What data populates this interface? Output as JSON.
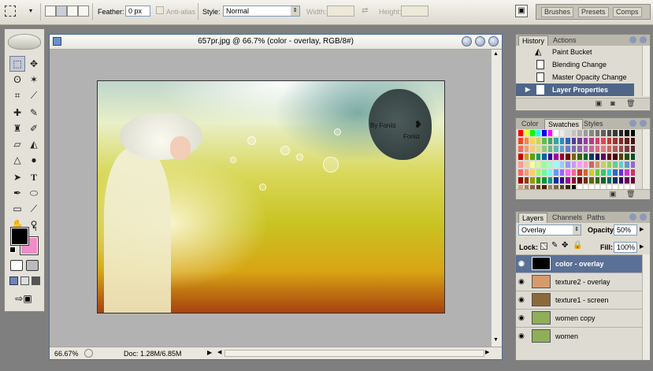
{
  "options_bar": {
    "feather_label": "Feather:",
    "feather_value": "0 px",
    "antialias_label": "Anti-alias",
    "style_label": "Style:",
    "style_value": "Normal",
    "width_label": "Width:",
    "height_label": "Height:"
  },
  "palette_well": {
    "tabs": [
      "Brushes",
      "Presets",
      "Comps"
    ]
  },
  "document": {
    "title": "657pr.jpg @ 66.7% (color - overlay, RGB/8#)",
    "zoom": "66.67%",
    "doc_info": "Doc: 1.28M/6.85M",
    "artwork_text_1": "By Foniiz",
    "artwork_text_2": "Foniiz"
  },
  "history_panel": {
    "tabs": [
      "History",
      "Actions"
    ],
    "items": [
      {
        "label": "Paint Bucket",
        "selected": false
      },
      {
        "label": "Blending Change",
        "selected": false
      },
      {
        "label": "Master Opacity Change",
        "selected": false
      },
      {
        "label": "Layer Properties",
        "selected": true
      }
    ]
  },
  "swatches_panel": {
    "tabs": [
      "Color",
      "Swatches",
      "Styles"
    ],
    "colors": [
      "#ff0000",
      "#ffff00",
      "#00ff00",
      "#00ffff",
      "#0000ff",
      "#ff00ff",
      "#ffffff",
      "#ebebeb",
      "#d7d7d7",
      "#c3c3c3",
      "#afafaf",
      "#9b9b9b",
      "#878787",
      "#737373",
      "#5f5f5f",
      "#4b4b4b",
      "#373737",
      "#232323",
      "#0f0f0f",
      "#000000",
      "#f0462d",
      "#f5873c",
      "#fad250",
      "#c8dc3c",
      "#64be46",
      "#3caa64",
      "#32a5a0",
      "#2d8cc8",
      "#3264b4",
      "#503ca0",
      "#6e3c9b",
      "#913ca0",
      "#b43c8c",
      "#d23c6e",
      "#e1465a",
      "#be3c3c",
      "#a03232",
      "#822828",
      "#641e1e",
      "#461414",
      "#f26d5b",
      "#f49d6e",
      "#f7c87e",
      "#d6e07a",
      "#8fcc7b",
      "#69b98a",
      "#63b7b3",
      "#5fa1d2",
      "#6682c2",
      "#7d68b3",
      "#9067ad",
      "#aa66b0",
      "#c867a0",
      "#e06a86",
      "#e57a82",
      "#cc6666",
      "#b45a5a",
      "#964b4b",
      "#783c3c",
      "#5a2d2d",
      "#c80000",
      "#c8a000",
      "#64a000",
      "#00a064",
      "#0064a0",
      "#3200a0",
      "#a000a0",
      "#a00032",
      "#780000",
      "#786400",
      "#3c6400",
      "#00643c",
      "#003c64",
      "#1e0064",
      "#640064",
      "#64001e",
      "#500000",
      "#504000",
      "#285000",
      "#005028",
      "#ff9999",
      "#ffcc99",
      "#ffff99",
      "#ccff99",
      "#99ff99",
      "#99ffcc",
      "#99ffff",
      "#99ccff",
      "#9999ff",
      "#cc99ff",
      "#ff99ff",
      "#ff99cc",
      "#cc6666",
      "#cc9966",
      "#cccc66",
      "#99cc66",
      "#66cc99",
      "#66cccc",
      "#6699cc",
      "#9966cc",
      "#ff6666",
      "#ff9966",
      "#ffcc66",
      "#99ff66",
      "#66ff99",
      "#66ffff",
      "#6699ff",
      "#9966ff",
      "#ff66ff",
      "#ff6699",
      "#cc3333",
      "#cc6633",
      "#cccc33",
      "#66cc33",
      "#33cc66",
      "#33cccc",
      "#3366cc",
      "#6633cc",
      "#cc33cc",
      "#cc3366",
      "#990000",
      "#993300",
      "#999900",
      "#339900",
      "#009933",
      "#009999",
      "#003399",
      "#330099",
      "#990099",
      "#990033",
      "#660000",
      "#663300",
      "#666600",
      "#336600",
      "#006633",
      "#006666",
      "#003366",
      "#330066",
      "#660066",
      "#660033",
      "#c8a882",
      "#a88460",
      "#886040",
      "#684020",
      "#482000",
      "#9c8468",
      "#7c6448",
      "#5c4428",
      "#3c2408",
      "#000000",
      "#ffffff",
      "#ffffff",
      "#ffffff",
      "#ffffff",
      "#ffffff",
      "#ffffff",
      "#ffffff",
      "#ffffff",
      "#ffffff",
      "#ffffff"
    ]
  },
  "layers_panel": {
    "tabs": [
      "Layers",
      "Channels",
      "Paths"
    ],
    "blend_mode": "Overlay",
    "opacity_label": "Opacity:",
    "opacity_value": "50%",
    "lock_label": "Lock:",
    "fill_label": "Fill:",
    "fill_value": "100%",
    "layers": [
      {
        "name": "color - overlay",
        "selected": true,
        "thumb": "#000000"
      },
      {
        "name": "texture2 - overlay",
        "selected": false,
        "thumb": "#d79a6e"
      },
      {
        "name": "texture1 - screen",
        "selected": false,
        "thumb": "#8a6a3a"
      },
      {
        "name": "women copy",
        "selected": false,
        "thumb": "#8fae5a"
      },
      {
        "name": "women",
        "selected": false,
        "thumb": "#8fae5a"
      }
    ]
  },
  "colors": {
    "foreground": "#000000",
    "background": "#f08cc8",
    "selection": "#4f6689"
  }
}
